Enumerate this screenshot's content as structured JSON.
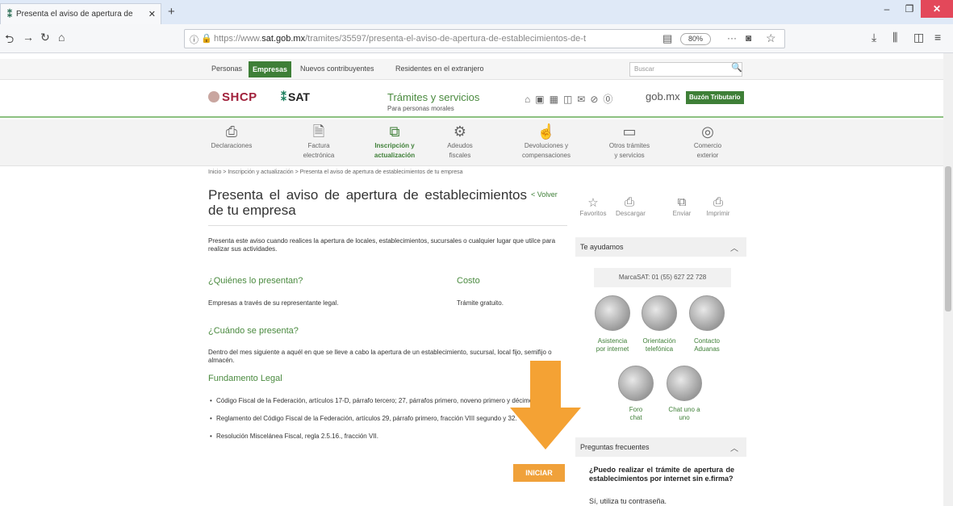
{
  "browser": {
    "tab_title": "Presenta el aviso de apertura de",
    "url_prefix": "https://www.",
    "url_host": "sat.gob.mx",
    "url_path": "/tramites/35597/presenta-el-aviso-de-apertura-de-establecimientos-de-t",
    "zoom": "80%"
  },
  "topnav": {
    "items": [
      "Personas",
      "Empresas",
      "Nuevos contribuyentes",
      "Residentes en el extranjero"
    ],
    "search_placeholder": "Buscar"
  },
  "header": {
    "shcp": "SHCP",
    "sat": "SAT",
    "tramites": "Trámites y servicios",
    "tramites_sub": "Para personas morales",
    "gobmx": "gob.mx",
    "buzon": "Buzón Tributario"
  },
  "categories": [
    {
      "label1": "Declaraciones",
      "label2": ""
    },
    {
      "label1": "Factura",
      "label2": "electrónica"
    },
    {
      "label1": "Inscripción y",
      "label2": "actualización"
    },
    {
      "label1": "Adeudos",
      "label2": "fiscales"
    },
    {
      "label1": "Devoluciones y",
      "label2": "compensaciones"
    },
    {
      "label1": "Otros trámites",
      "label2": "y servicios"
    },
    {
      "label1": "Comercio",
      "label2": "exterior"
    }
  ],
  "main": {
    "breadcrumb": "Inicio > Inscripción y actualización > Presenta el aviso de apertura de establecimientos de tu empresa",
    "title": "Presenta el aviso de apertura de establecimientos de tu empresa",
    "volver": "< Volver",
    "intro": "Presenta este aviso cuando realices la apertura de locales, establecimientos, sucursales o cualquier lugar que utilce para realizar sus actividades.",
    "quienes_h": "¿Quiénes lo presentan?",
    "quienes_p": "Empresas a través de su representante legal.",
    "costo_h": "Costo",
    "costo_p": "Trámite gratuito.",
    "cuando_h": "¿Cuándo se presenta?",
    "cuando_p": "Dentro del mes siguiente a aquél en que se lleve a cabo la apertura de un establecimiento, sucursal, local fijo, semifijo o almacén.",
    "fundamento_h": "Fundamento Legal",
    "fundamento": [
      "Código Fiscal de la Federación, artículos 17-D, párrafo tercero; 27, párrafos primero, noveno primero y décimo tercero.",
      "Reglamento del Código Fiscal de la Federación, artículos 29, párrafo primero, fracción VIII segundo y 32.",
      "Resolución Miscelánea Fiscal, regla 2.5.16., fracción VII."
    ],
    "iniciar": "INICIAR"
  },
  "right": {
    "actions": [
      "Favoritos",
      "Descargar",
      "Enviar",
      "Imprimir"
    ],
    "te_ayudamos": "Te ayudamos",
    "marcasat": "MarcaSAT: 01 (55) 627 22 728",
    "help": [
      {
        "l1": "Asistencia",
        "l2": "por internet"
      },
      {
        "l1": "Orientación",
        "l2": "telefónica"
      },
      {
        "l1": "Contacto",
        "l2": "Aduanas"
      },
      {
        "l1": "Foro",
        "l2": "chat"
      },
      {
        "l1": "Chat uno a",
        "l2": "uno"
      }
    ],
    "preguntas": "Preguntas frecuentes",
    "faq_q": "¿Puedo realizar el trámite de apertura de establecimientos por internet sin e.firma?",
    "faq_a": "Sí, utiliza tu contraseña."
  }
}
